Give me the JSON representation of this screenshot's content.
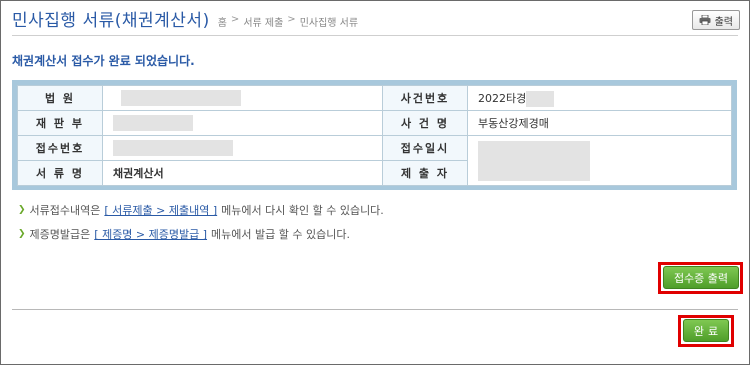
{
  "header": {
    "title": "민사집행 서류(채권계산서)",
    "breadcrumb": [
      "홈",
      "서류 제출",
      "민사집행 서류"
    ],
    "breadcrumb_sep": ">",
    "print_label": "출력"
  },
  "message": "채권계산서 접수가 완료 되었습니다.",
  "info": {
    "court_label": "법 원",
    "case_no_label": "사건번호",
    "case_no_value": "2022타경",
    "division_label": "재 판 부",
    "case_name_label": "사 건 명",
    "case_name_value": "부동산강제경매",
    "receipt_no_label": "접수번호",
    "receipt_dt_label": "접수일시",
    "doc_name_label": "서 류 명",
    "doc_name_value": "채권계산서",
    "submitter_label": "제 출 자"
  },
  "notes": [
    {
      "pre": "서류접수내역은",
      "link": "[ 서류제출 > 제출내역 ]",
      "post": "메뉴에서 다시 확인 할 수 있습니다."
    },
    {
      "pre": "제증명발급은",
      "link": "[ 제증명 > 제증명발급 ]",
      "post": "메뉴에서 발급 할 수 있습니다."
    }
  ],
  "buttons": {
    "receipt_print": "접수증 출력",
    "done": "완료"
  },
  "colors": {
    "title_blue": "#2a5aa6",
    "button_green": "#5aa831",
    "highlight_red": "#e00000",
    "table_frame": "#a8c8dc"
  }
}
